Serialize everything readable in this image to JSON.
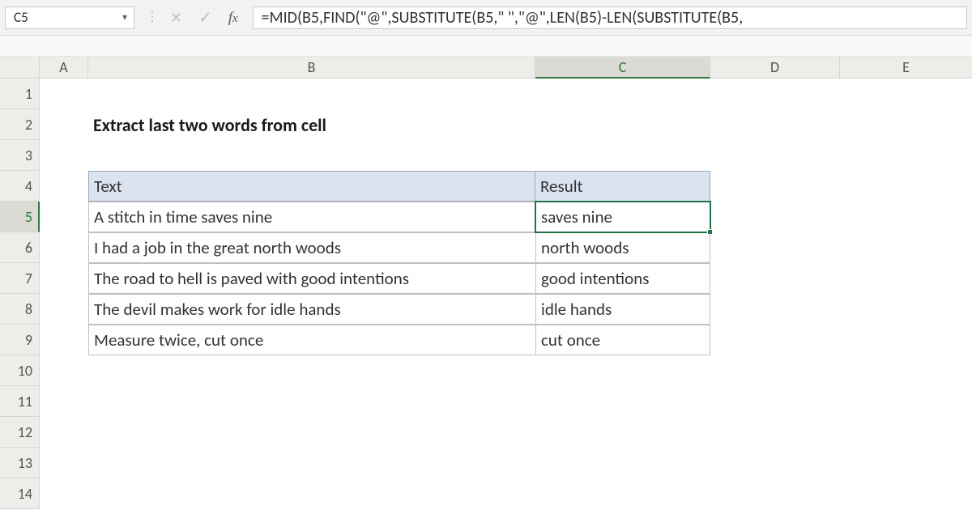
{
  "namebox": {
    "value": "C5"
  },
  "formula_bar": {
    "value": "=MID(B5,FIND(\"@\",SUBSTITUTE(B5,\" \",\"@\",LEN(B5)-LEN(SUBSTITUTE(B5,"
  },
  "columns": [
    "A",
    "B",
    "C",
    "D",
    "E"
  ],
  "row_numbers": [
    "1",
    "2",
    "3",
    "4",
    "5",
    "6",
    "7",
    "8",
    "9",
    "10",
    "11",
    "12",
    "13",
    "14"
  ],
  "title": "Extract last two words from cell",
  "headers": {
    "text": "Text",
    "result": "Result"
  },
  "rows": [
    {
      "text": "A stitch in time saves nine",
      "result": "saves nine"
    },
    {
      "text": "I had a job in the great north woods",
      "result": "north woods"
    },
    {
      "text": "The road to hell is paved with good intentions",
      "result": "good intentions"
    },
    {
      "text": "The devil makes work for idle hands",
      "result": "idle hands"
    },
    {
      "text": "Measure twice, cut once",
      "result": "cut once"
    }
  ],
  "selected": {
    "row": 5,
    "col": "C"
  }
}
